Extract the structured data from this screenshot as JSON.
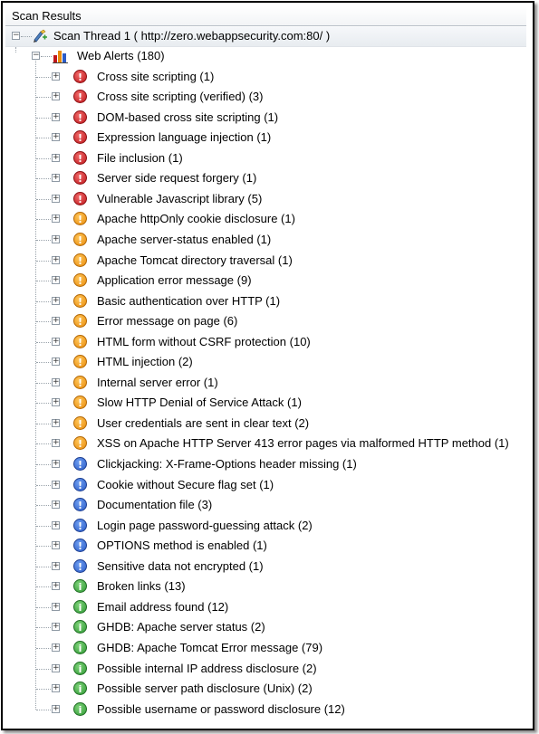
{
  "panel": {
    "title": "Scan Results"
  },
  "thread": {
    "label": "Scan Thread 1 ( http://zero.webappsecurity.com:80/ )",
    "icon": "scan-thread-icon"
  },
  "group": {
    "label": "Web Alerts (180)",
    "icon": "web-alerts-chart-icon"
  },
  "colors": {
    "high": "#c0171b",
    "medium": "#e88a0a",
    "low": "#2b5cc8",
    "info": "#2f9a34"
  },
  "alerts": [
    {
      "label": "Cross site scripting (1)",
      "severity": "high",
      "glyph": "!"
    },
    {
      "label": "Cross site scripting (verified) (3)",
      "severity": "high",
      "glyph": "!"
    },
    {
      "label": "DOM-based cross site scripting (1)",
      "severity": "high",
      "glyph": "!"
    },
    {
      "label": "Expression language injection (1)",
      "severity": "high",
      "glyph": "!"
    },
    {
      "label": "File inclusion (1)",
      "severity": "high",
      "glyph": "!"
    },
    {
      "label": "Server side request forgery (1)",
      "severity": "high",
      "glyph": "!"
    },
    {
      "label": "Vulnerable Javascript library (5)",
      "severity": "high",
      "glyph": "!"
    },
    {
      "label": "Apache httpOnly cookie disclosure (1)",
      "severity": "medium",
      "glyph": "!"
    },
    {
      "label": "Apache server-status enabled (1)",
      "severity": "medium",
      "glyph": "!"
    },
    {
      "label": "Apache Tomcat directory traversal (1)",
      "severity": "medium",
      "glyph": "!"
    },
    {
      "label": "Application error message (9)",
      "severity": "medium",
      "glyph": "!"
    },
    {
      "label": "Basic authentication over HTTP (1)",
      "severity": "medium",
      "glyph": "!"
    },
    {
      "label": "Error message on page (6)",
      "severity": "medium",
      "glyph": "!"
    },
    {
      "label": "HTML form without CSRF protection (10)",
      "severity": "medium",
      "glyph": "!"
    },
    {
      "label": "HTML injection (2)",
      "severity": "medium",
      "glyph": "!"
    },
    {
      "label": "Internal server error (1)",
      "severity": "medium",
      "glyph": "!"
    },
    {
      "label": "Slow HTTP Denial of Service Attack (1)",
      "severity": "medium",
      "glyph": "!"
    },
    {
      "label": "User credentials are sent in clear text (2)",
      "severity": "medium",
      "glyph": "!"
    },
    {
      "label": "XSS on Apache HTTP Server 413 error pages via malformed HTTP method (1)",
      "severity": "medium",
      "glyph": "!"
    },
    {
      "label": "Clickjacking: X-Frame-Options header missing (1)",
      "severity": "low",
      "glyph": "!"
    },
    {
      "label": "Cookie without Secure flag set (1)",
      "severity": "low",
      "glyph": "!"
    },
    {
      "label": "Documentation file (3)",
      "severity": "low",
      "glyph": "!"
    },
    {
      "label": "Login page password-guessing attack (2)",
      "severity": "low",
      "glyph": "!"
    },
    {
      "label": "OPTIONS method is enabled (1)",
      "severity": "low",
      "glyph": "!"
    },
    {
      "label": "Sensitive data not encrypted (1)",
      "severity": "low",
      "glyph": "!"
    },
    {
      "label": "Broken links (13)",
      "severity": "info",
      "glyph": "i"
    },
    {
      "label": "Email address found (12)",
      "severity": "info",
      "glyph": "i"
    },
    {
      "label": "GHDB: Apache server status (2)",
      "severity": "info",
      "glyph": "i"
    },
    {
      "label": "GHDB: Apache Tomcat Error message (79)",
      "severity": "info",
      "glyph": "i"
    },
    {
      "label": "Possible internal IP address disclosure (2)",
      "severity": "info",
      "glyph": "i"
    },
    {
      "label": "Possible server path disclosure (Unix) (2)",
      "severity": "info",
      "glyph": "i"
    },
    {
      "label": "Possible username or password disclosure (12)",
      "severity": "info",
      "glyph": "i"
    }
  ]
}
